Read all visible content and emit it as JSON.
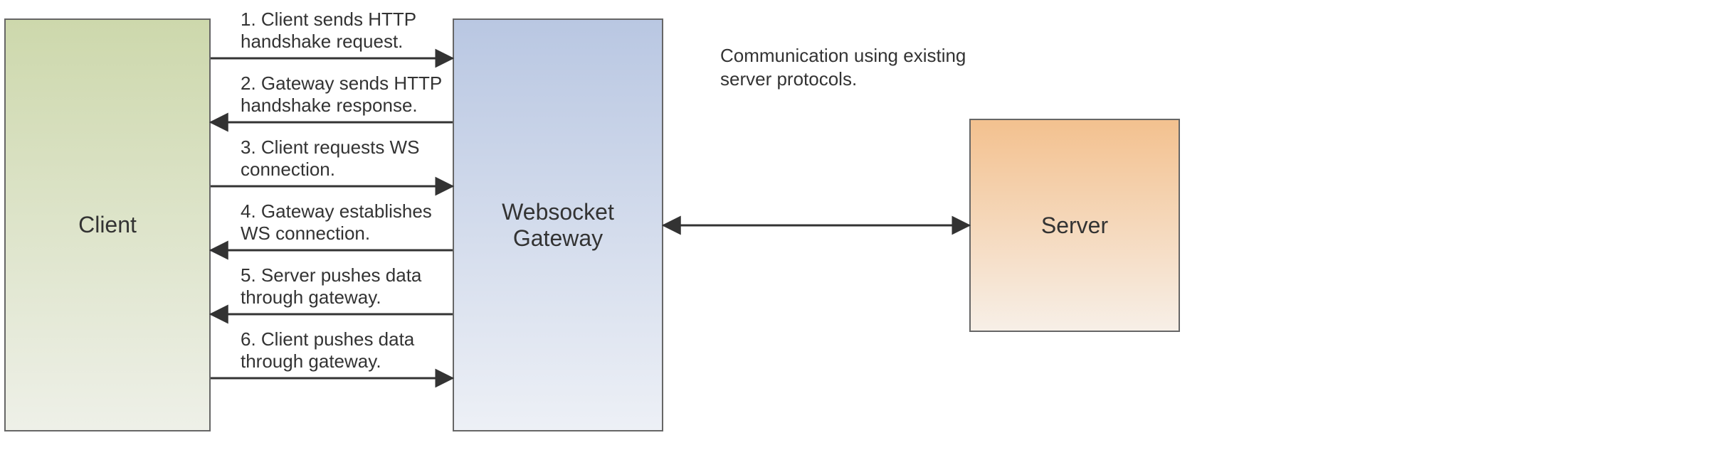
{
  "boxes": {
    "client": "Client",
    "gateway": "Websocket Gateway",
    "server": "Server"
  },
  "steps": {
    "s1": "1. Client sends HTTP handshake request.",
    "s2": "2. Gateway sends HTTP handshake response.",
    "s3": "3. Client requests WS connection.",
    "s4": "4. Gateway establishes WS connection.",
    "s5": "5. Server pushes data through gateway.",
    "s6": "6. Client pushes data through gateway."
  },
  "comm": "Communication using existing server protocols."
}
